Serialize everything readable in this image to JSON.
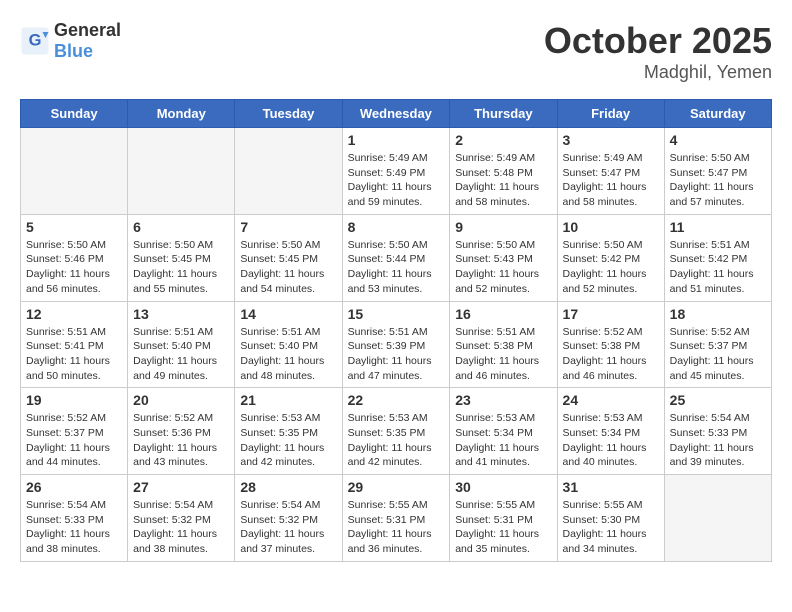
{
  "header": {
    "logo_general": "General",
    "logo_blue": "Blue",
    "month": "October 2025",
    "location": "Madghil, Yemen"
  },
  "weekdays": [
    "Sunday",
    "Monday",
    "Tuesday",
    "Wednesday",
    "Thursday",
    "Friday",
    "Saturday"
  ],
  "weeks": [
    [
      {
        "day": "",
        "info": ""
      },
      {
        "day": "",
        "info": ""
      },
      {
        "day": "",
        "info": ""
      },
      {
        "day": "1",
        "info": "Sunrise: 5:49 AM\nSunset: 5:49 PM\nDaylight: 11 hours\nand 59 minutes."
      },
      {
        "day": "2",
        "info": "Sunrise: 5:49 AM\nSunset: 5:48 PM\nDaylight: 11 hours\nand 58 minutes."
      },
      {
        "day": "3",
        "info": "Sunrise: 5:49 AM\nSunset: 5:47 PM\nDaylight: 11 hours\nand 58 minutes."
      },
      {
        "day": "4",
        "info": "Sunrise: 5:50 AM\nSunset: 5:47 PM\nDaylight: 11 hours\nand 57 minutes."
      }
    ],
    [
      {
        "day": "5",
        "info": "Sunrise: 5:50 AM\nSunset: 5:46 PM\nDaylight: 11 hours\nand 56 minutes."
      },
      {
        "day": "6",
        "info": "Sunrise: 5:50 AM\nSunset: 5:45 PM\nDaylight: 11 hours\nand 55 minutes."
      },
      {
        "day": "7",
        "info": "Sunrise: 5:50 AM\nSunset: 5:45 PM\nDaylight: 11 hours\nand 54 minutes."
      },
      {
        "day": "8",
        "info": "Sunrise: 5:50 AM\nSunset: 5:44 PM\nDaylight: 11 hours\nand 53 minutes."
      },
      {
        "day": "9",
        "info": "Sunrise: 5:50 AM\nSunset: 5:43 PM\nDaylight: 11 hours\nand 52 minutes."
      },
      {
        "day": "10",
        "info": "Sunrise: 5:50 AM\nSunset: 5:42 PM\nDaylight: 11 hours\nand 52 minutes."
      },
      {
        "day": "11",
        "info": "Sunrise: 5:51 AM\nSunset: 5:42 PM\nDaylight: 11 hours\nand 51 minutes."
      }
    ],
    [
      {
        "day": "12",
        "info": "Sunrise: 5:51 AM\nSunset: 5:41 PM\nDaylight: 11 hours\nand 50 minutes."
      },
      {
        "day": "13",
        "info": "Sunrise: 5:51 AM\nSunset: 5:40 PM\nDaylight: 11 hours\nand 49 minutes."
      },
      {
        "day": "14",
        "info": "Sunrise: 5:51 AM\nSunset: 5:40 PM\nDaylight: 11 hours\nand 48 minutes."
      },
      {
        "day": "15",
        "info": "Sunrise: 5:51 AM\nSunset: 5:39 PM\nDaylight: 11 hours\nand 47 minutes."
      },
      {
        "day": "16",
        "info": "Sunrise: 5:51 AM\nSunset: 5:38 PM\nDaylight: 11 hours\nand 46 minutes."
      },
      {
        "day": "17",
        "info": "Sunrise: 5:52 AM\nSunset: 5:38 PM\nDaylight: 11 hours\nand 46 minutes."
      },
      {
        "day": "18",
        "info": "Sunrise: 5:52 AM\nSunset: 5:37 PM\nDaylight: 11 hours\nand 45 minutes."
      }
    ],
    [
      {
        "day": "19",
        "info": "Sunrise: 5:52 AM\nSunset: 5:37 PM\nDaylight: 11 hours\nand 44 minutes."
      },
      {
        "day": "20",
        "info": "Sunrise: 5:52 AM\nSunset: 5:36 PM\nDaylight: 11 hours\nand 43 minutes."
      },
      {
        "day": "21",
        "info": "Sunrise: 5:53 AM\nSunset: 5:35 PM\nDaylight: 11 hours\nand 42 minutes."
      },
      {
        "day": "22",
        "info": "Sunrise: 5:53 AM\nSunset: 5:35 PM\nDaylight: 11 hours\nand 42 minutes."
      },
      {
        "day": "23",
        "info": "Sunrise: 5:53 AM\nSunset: 5:34 PM\nDaylight: 11 hours\nand 41 minutes."
      },
      {
        "day": "24",
        "info": "Sunrise: 5:53 AM\nSunset: 5:34 PM\nDaylight: 11 hours\nand 40 minutes."
      },
      {
        "day": "25",
        "info": "Sunrise: 5:54 AM\nSunset: 5:33 PM\nDaylight: 11 hours\nand 39 minutes."
      }
    ],
    [
      {
        "day": "26",
        "info": "Sunrise: 5:54 AM\nSunset: 5:33 PM\nDaylight: 11 hours\nand 38 minutes."
      },
      {
        "day": "27",
        "info": "Sunrise: 5:54 AM\nSunset: 5:32 PM\nDaylight: 11 hours\nand 38 minutes."
      },
      {
        "day": "28",
        "info": "Sunrise: 5:54 AM\nSunset: 5:32 PM\nDaylight: 11 hours\nand 37 minutes."
      },
      {
        "day": "29",
        "info": "Sunrise: 5:55 AM\nSunset: 5:31 PM\nDaylight: 11 hours\nand 36 minutes."
      },
      {
        "day": "30",
        "info": "Sunrise: 5:55 AM\nSunset: 5:31 PM\nDaylight: 11 hours\nand 35 minutes."
      },
      {
        "day": "31",
        "info": "Sunrise: 5:55 AM\nSunset: 5:30 PM\nDaylight: 11 hours\nand 34 minutes."
      },
      {
        "day": "",
        "info": ""
      }
    ]
  ]
}
